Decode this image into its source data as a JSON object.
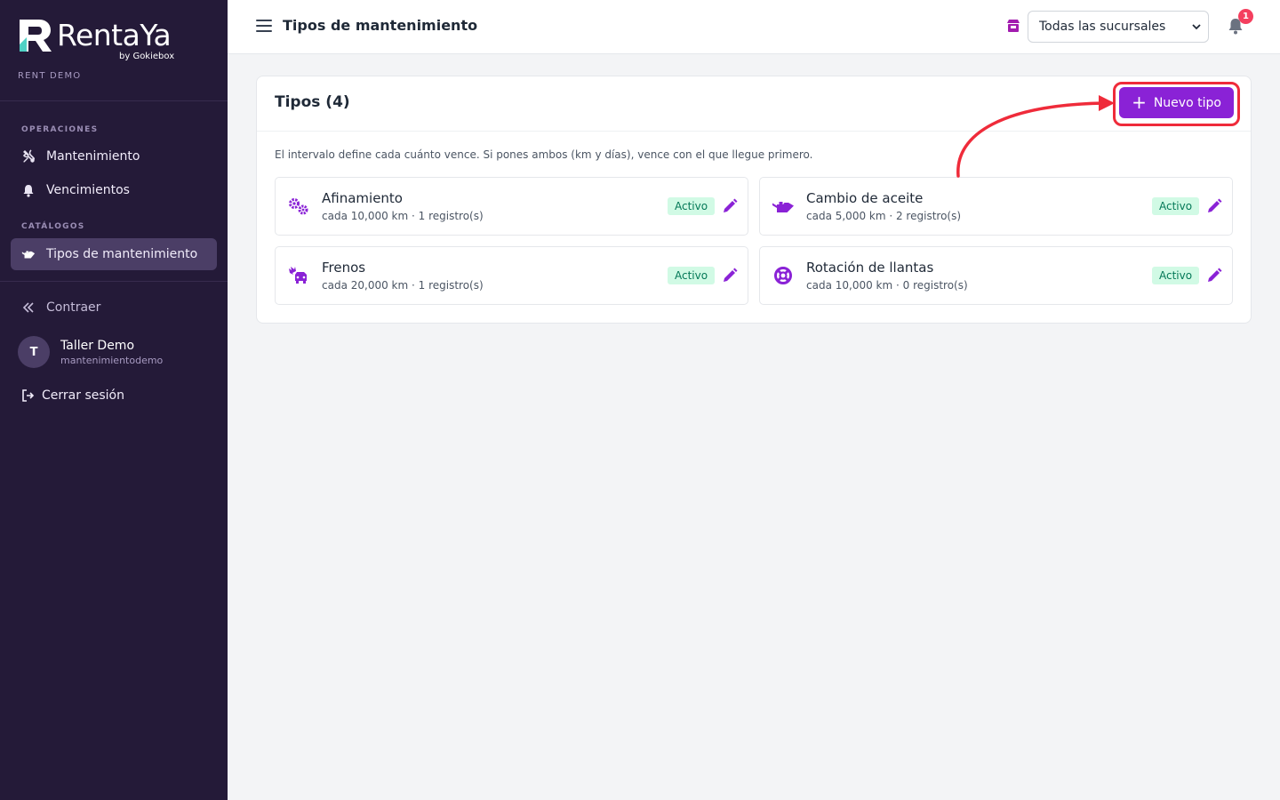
{
  "sidebar": {
    "brand_name": "RentaYa",
    "brand_by": "by Gokiebox",
    "workspace": "RENT DEMO",
    "sections": [
      {
        "label": "OPERACIONES",
        "items": [
          {
            "label": "Mantenimiento",
            "icon": "tools-icon"
          },
          {
            "label": "Vencimientos",
            "icon": "bell-icon"
          }
        ]
      },
      {
        "label": "CATÁLOGOS",
        "items": [
          {
            "label": "Tipos de mantenimiento",
            "icon": "oil-can-icon",
            "active": true
          }
        ]
      }
    ],
    "collapse_label": "Contraer",
    "user": {
      "initial": "T",
      "name": "Taller Demo",
      "handle": "mantenimientodemo"
    },
    "logout_label": "Cerrar sesión"
  },
  "topbar": {
    "title": "Tipos de mantenimiento",
    "branch_select_value": "Todas las sucursales",
    "notification_count": "1"
  },
  "card": {
    "title": "Tipos (4)",
    "new_button_label": "Nuevo tipo",
    "hint": "El intervalo define cada cuánto vence. Si pones ambos (km y días), vence con el que llegue primero.",
    "types": [
      {
        "name": "Afinamiento",
        "meta": "cada 10,000 km · 1 registro(s)",
        "status": "Activo",
        "icon": "gears-icon"
      },
      {
        "name": "Cambio de aceite",
        "meta": "cada 5,000 km · 2 registro(s)",
        "status": "Activo",
        "icon": "oil-can-icon"
      },
      {
        "name": "Frenos",
        "meta": "cada 20,000 km · 1 registro(s)",
        "status": "Activo",
        "icon": "car-burst-icon"
      },
      {
        "name": "Rotación de llantas",
        "meta": "cada 10,000 km · 0 registro(s)",
        "status": "Activo",
        "icon": "life-ring-icon"
      }
    ]
  },
  "colors": {
    "sidebar_bg": "#241a38",
    "accent": "#8a22d6",
    "annotation": "#ef2b3a",
    "badge_bg": "#d1fae5",
    "badge_text": "#047857"
  }
}
